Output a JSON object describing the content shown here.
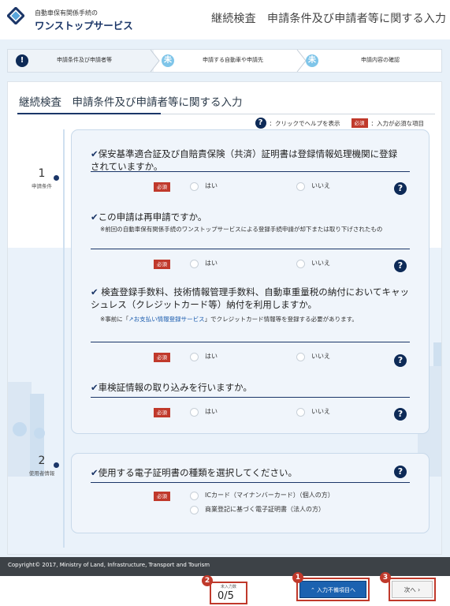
{
  "header": {
    "logo_small": "自動車保有関係手続の",
    "logo_main": "ワンストップサービス",
    "page_heading": "継続検査　申請条件及び申請者等に関する入力"
  },
  "steps": [
    {
      "num": "!",
      "label": "申請条件及び申請者等"
    },
    {
      "num": "未",
      "label": "申請する自動車や申請先"
    },
    {
      "num": "未",
      "label": "申請内容の確認"
    }
  ],
  "panel": {
    "title": "継続検査　申請条件及び申請者等に関する入力",
    "help_legend_text": "：クリックでヘルプを表示",
    "required_legend_text": "：入力が必須な項目"
  },
  "required_badge": "必須",
  "help_glyph": "?",
  "check_glyph": "✔",
  "sections": [
    {
      "num": "1",
      "label": "申請条件"
    },
    {
      "num": "2",
      "label": "使用者情報"
    }
  ],
  "questions": [
    {
      "text": "保安基準適合証及び自賠責保険（共済）証明書は登録情報処理機関に登録されていますか。",
      "options": [
        "はい",
        "いいえ"
      ]
    },
    {
      "text": "この申請は再申請ですか。",
      "note": "※前回の自動車保有関係手続のワンストップサービスによる登録手続申請が却下または取り下げされたもの",
      "options": [
        "はい",
        "いいえ"
      ]
    },
    {
      "text": " 検査登録手数料、技術情報管理手数料、自動車重量税の納付においてキャッシュレス（クレジットカード等）納付を利用しますか。",
      "note_prefix": "※事前に「",
      "note_link": "お支払い情報登録サービス",
      "note_suffix": "」でクレジットカード情報等を登録する必要があります。",
      "options": [
        "はい",
        "いいえ"
      ]
    },
    {
      "text": "車検証情報の取り込みを行いますか。",
      "options": [
        "はい",
        "いいえ"
      ]
    },
    {
      "text": "使用する電子証明書の種類を選択してください。",
      "options": [
        "ICカード（マイナンバーカード）（個人の方）",
        "商業登記に基づく電子証明書（法人の方）"
      ]
    }
  ],
  "footer": {
    "copyright": "Copyright© 2017, Ministry of Land, Infrastructure, Transport and Tourism"
  },
  "bottom": {
    "counter_label": "未入力数",
    "counter_value": "0/5",
    "required_button": "入力不備項目へ",
    "next_button": "次へ ›",
    "markers": [
      "1",
      "2",
      "3"
    ]
  },
  "colors": {
    "brand": "#1b3668",
    "required": "#c0392b",
    "accent_blue": "#1b62b0"
  }
}
